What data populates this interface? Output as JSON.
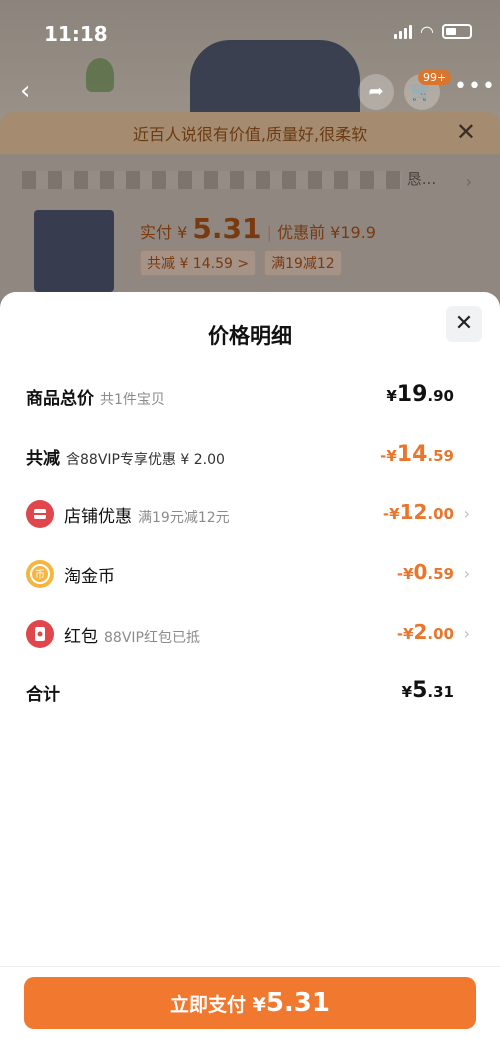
{
  "status": {
    "time": "11:18"
  },
  "background": {
    "banner_text": "近百人说很有价值,质量好,很柔软",
    "address_tail": "恳...",
    "pay_label": "实付",
    "pay_currency": "¥",
    "pay_amount": "5.31",
    "before_label": "优惠前",
    "before_amount": "¥19.9",
    "tag_reduce": "共减 ¥ 14.59 >",
    "tag_promo": "满19减12",
    "cart_badge": "99+"
  },
  "sheet": {
    "title": "价格明细",
    "rows": [
      {
        "label": "商品总价",
        "sub": "共1件宝贝",
        "value_prefix": "¥",
        "value_main": "19",
        "value_decimal": ".90"
      },
      {
        "label": "共减",
        "sub": "含88VIP专享优惠 ¥ 2.00",
        "value_prefix": "-¥",
        "value_main": "14",
        "value_decimal": ".59"
      },
      {
        "label": "店铺优惠",
        "sub": "满19元减12元",
        "value_prefix": "-¥",
        "value_main": "12",
        "value_decimal": ".00",
        "icon": "shop-icon"
      },
      {
        "label": "淘金币",
        "sub": "",
        "value_prefix": "-¥",
        "value_main": "0",
        "value_decimal": ".59",
        "icon": "coin-icon"
      },
      {
        "label": "红包",
        "sub": "88VIP红包已抵",
        "value_prefix": "-¥",
        "value_main": "2",
        "value_decimal": ".00",
        "icon": "red-packet-icon"
      },
      {
        "label": "合计",
        "sub": "",
        "value_prefix": "¥",
        "value_main": "5",
        "value_decimal": ".31"
      }
    ]
  },
  "footer": {
    "pay_label": "立即支付 ¥",
    "pay_amount": "5.31"
  },
  "colors": {
    "accent": "#F0782F",
    "discount": "#E8762C",
    "shop_icon": "#E0474C",
    "coin_icon": "#F5B53F",
    "red_packet_icon": "#E0474C"
  }
}
